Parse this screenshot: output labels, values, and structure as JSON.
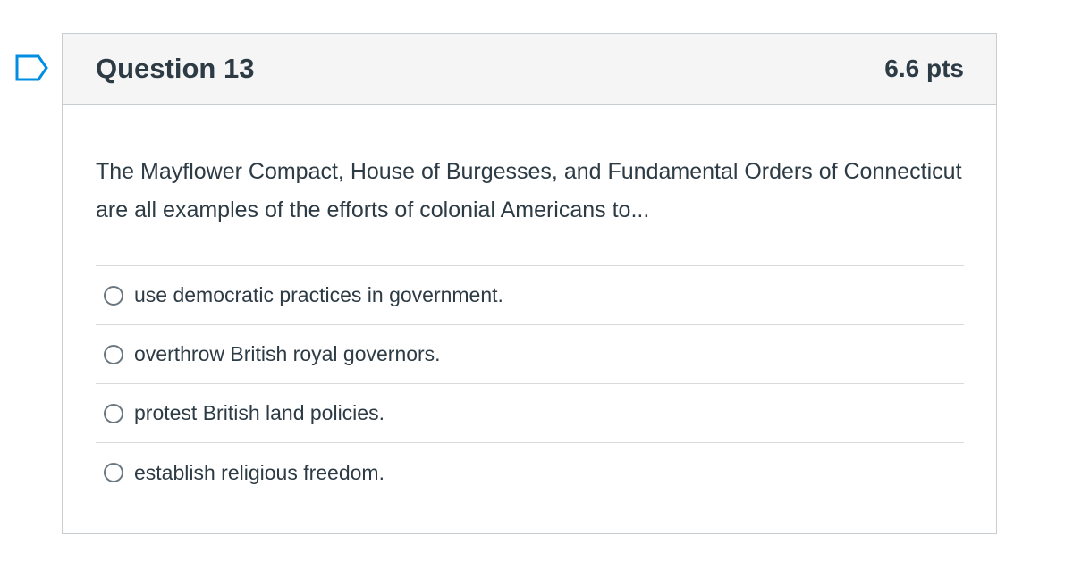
{
  "question": {
    "flag_icon": "flag-outline-icon",
    "title": "Question 13",
    "points": "6.6 pts",
    "text": "The Mayflower Compact, House of Burgesses, and Fundamental Orders of Connecticut are all examples of the efforts of colonial Americans to...",
    "answers": [
      {
        "label": "use democratic practices in government.",
        "selected": false
      },
      {
        "label": "overthrow British royal governors.",
        "selected": false
      },
      {
        "label": "protest British land policies.",
        "selected": false
      },
      {
        "label": "establish religious freedom.",
        "selected": false
      }
    ]
  },
  "colors": {
    "accent": "#008ee2",
    "header_bg": "#f5f5f5",
    "text": "#2d3b45",
    "border": "#c7cdd1"
  }
}
